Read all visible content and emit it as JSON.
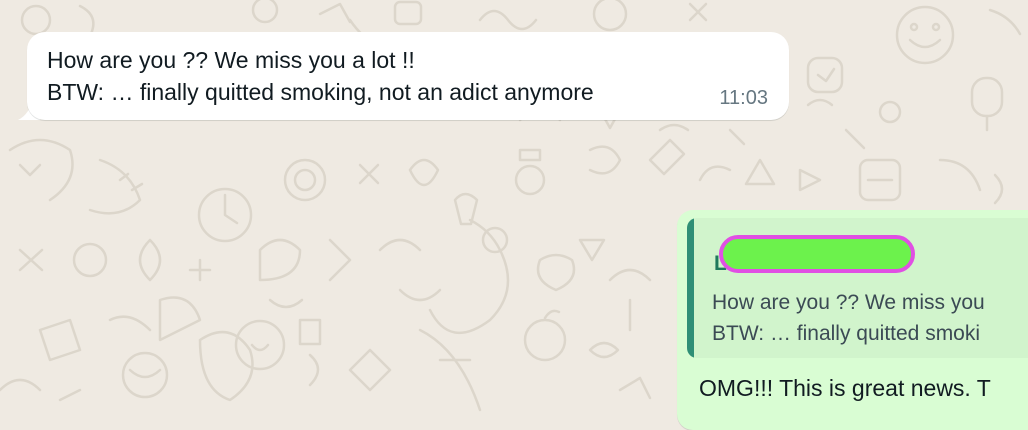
{
  "chat": {
    "background_color": "#efeae2",
    "incoming_message": {
      "line1": "How are you ?? We miss you a lot !!",
      "line2": "BTW: … finally quitted smoking, not an adict anymore",
      "time": "11:03"
    },
    "outgoing_message": {
      "quoted": {
        "author_initial": "L",
        "author_name_redacted": true,
        "line1": "How are you ?? We miss you",
        "line2": "BTW: … finally quitted smoki"
      },
      "text": "OMG!!! This is great news. T"
    }
  },
  "colors": {
    "incoming_bubble": "#ffffff",
    "outgoing_bubble": "#d9fdd3",
    "quote_background": "#d1f4cc",
    "quote_bar": "#2f8f76",
    "quote_author": "#1f7a5c",
    "timestamp": "#667781",
    "redaction_fill": "#6cf24c",
    "redaction_border": "#e04fe3"
  }
}
